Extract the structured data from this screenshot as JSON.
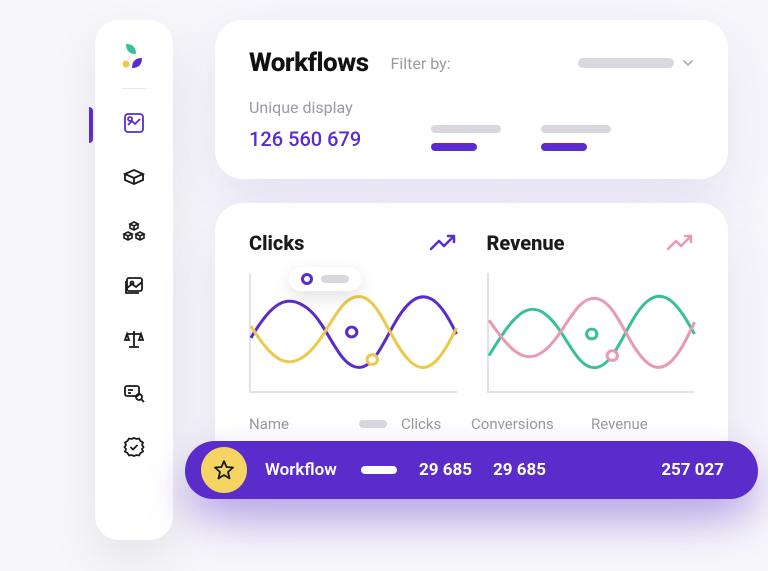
{
  "sidebar": {
    "icons": [
      "chart-pie",
      "box",
      "boxes",
      "image",
      "scale",
      "search-card",
      "badge"
    ]
  },
  "workflows": {
    "title": "Workflows",
    "filter_label": "Filter by:",
    "unique_label": "Unique display",
    "unique_value": "126 560 679"
  },
  "charts": {
    "clicks": {
      "title": "Clicks"
    },
    "revenue": {
      "title": "Revenue"
    },
    "headers": {
      "name": "Name",
      "clicks": "Clicks",
      "conversions": "Conversions",
      "revenue": "Revenue"
    }
  },
  "highlight": {
    "label": "Workflow",
    "clicks": "29 685",
    "conversions": "29 685",
    "revenue": "257 027"
  },
  "colors": {
    "purple": "#5b2ccc",
    "yellow": "#ebc94b",
    "teal": "#3bbf9b",
    "pink": "#e79ab0"
  },
  "chart_data": [
    {
      "type": "line",
      "title": "Clicks",
      "xlabel": "",
      "ylabel": "",
      "x": [
        0,
        1,
        2,
        3,
        4,
        5,
        6,
        7,
        8,
        9,
        10
      ],
      "series": [
        {
          "name": "purple",
          "color": "#5b2ccc",
          "values": [
            45,
            70,
            85,
            70,
            40,
            20,
            30,
            60,
            85,
            72,
            48
          ]
        },
        {
          "name": "yellow",
          "color": "#ebc94b",
          "values": [
            55,
            30,
            20,
            35,
            62,
            80,
            70,
            45,
            25,
            40,
            60
          ]
        }
      ]
    },
    {
      "type": "line",
      "title": "Revenue",
      "xlabel": "",
      "ylabel": "",
      "x": [
        0,
        1,
        2,
        3,
        4,
        5,
        6,
        7,
        8,
        9,
        10
      ],
      "series": [
        {
          "name": "teal",
          "color": "#3bbf9b",
          "values": [
            30,
            55,
            78,
            65,
            40,
            20,
            30,
            58,
            80,
            68,
            48
          ]
        },
        {
          "name": "pink",
          "color": "#e79ab0",
          "values": [
            60,
            38,
            25,
            40,
            62,
            80,
            70,
            48,
            28,
            42,
            62
          ]
        }
      ]
    }
  ]
}
